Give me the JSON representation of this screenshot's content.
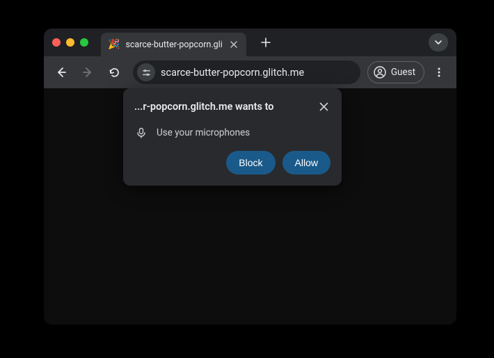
{
  "window": {
    "tab_title": "scarce-butter-popcorn.glitch",
    "favicon": "🎉"
  },
  "toolbar": {
    "url": "scarce-butter-popcorn.glitch.me",
    "guest_label": "Guest"
  },
  "permission": {
    "title": "...r-popcorn.glitch.me wants to",
    "request_text": "Use your microphones",
    "block_label": "Block",
    "allow_label": "Allow"
  }
}
